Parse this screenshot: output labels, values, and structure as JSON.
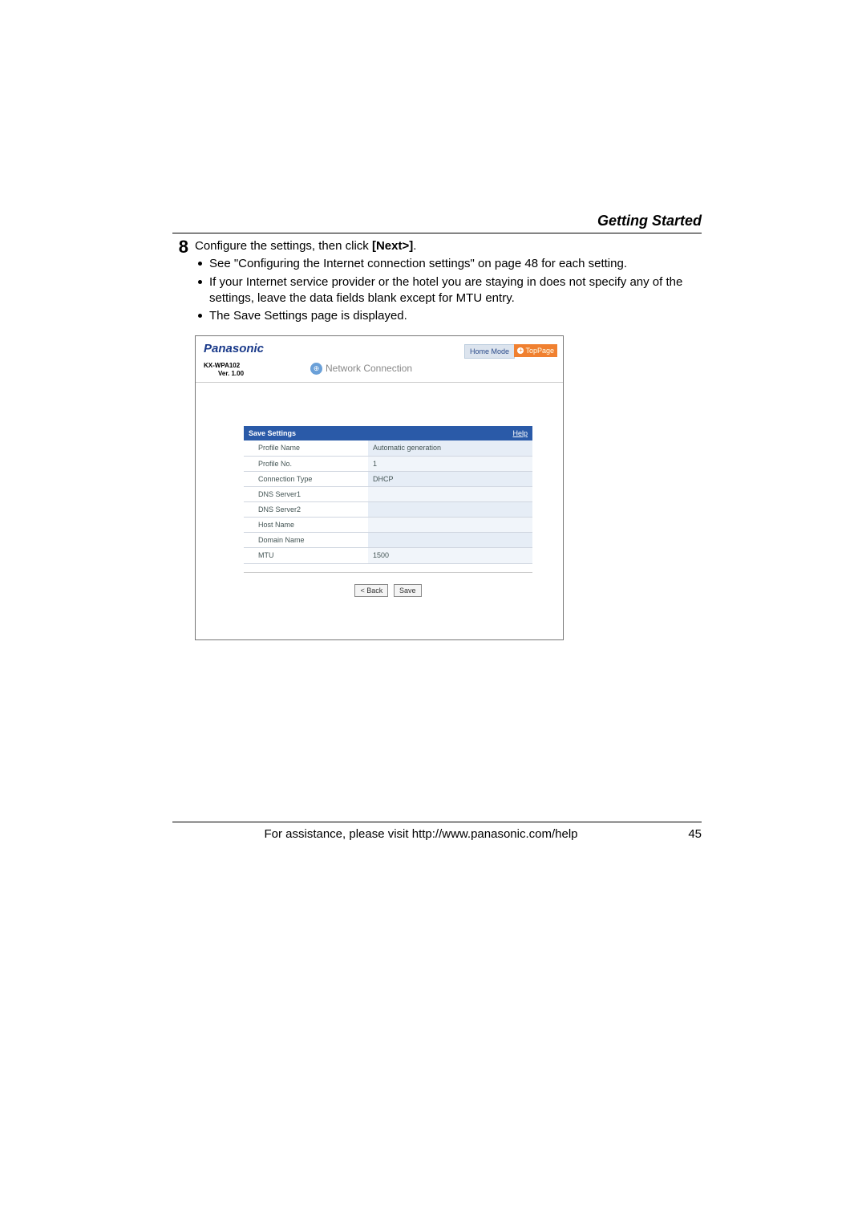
{
  "header": {
    "section_title": "Getting Started"
  },
  "step": {
    "number": "8",
    "main_pre": "Configure the settings, then click ",
    "main_bold": "[Next>]",
    "main_post": ".",
    "bullets": [
      "See \"Configuring the Internet connection settings\" on page 48 for each setting.",
      "If your Internet service provider or the hotel you are staying in does not specify any of the settings, leave the data fields blank except for MTU entry.",
      "The Save Settings page is displayed."
    ]
  },
  "screenshot": {
    "brand": "Panasonic",
    "model": "KX-WPA102",
    "version": "Ver. 1.00",
    "page_title": "Network Connection",
    "mode_label": "Home Mode",
    "top_page_label": "TopPage",
    "table_title": "Save Settings",
    "help_label": "Help",
    "rows": [
      {
        "label": "Profile Name",
        "value": "Automatic generation"
      },
      {
        "label": "Profile No.",
        "value": "1"
      },
      {
        "label": "Connection Type",
        "value": "DHCP"
      },
      {
        "label": "DNS Server1",
        "value": ""
      },
      {
        "label": "DNS Server2",
        "value": ""
      },
      {
        "label": "Host Name",
        "value": ""
      },
      {
        "label": "Domain Name",
        "value": ""
      },
      {
        "label": "MTU",
        "value": "1500"
      }
    ],
    "buttons": {
      "back": "< Back",
      "save": "Save"
    }
  },
  "footer": {
    "assist_text": "For assistance, please visit http://www.panasonic.com/help",
    "page_number": "45"
  }
}
